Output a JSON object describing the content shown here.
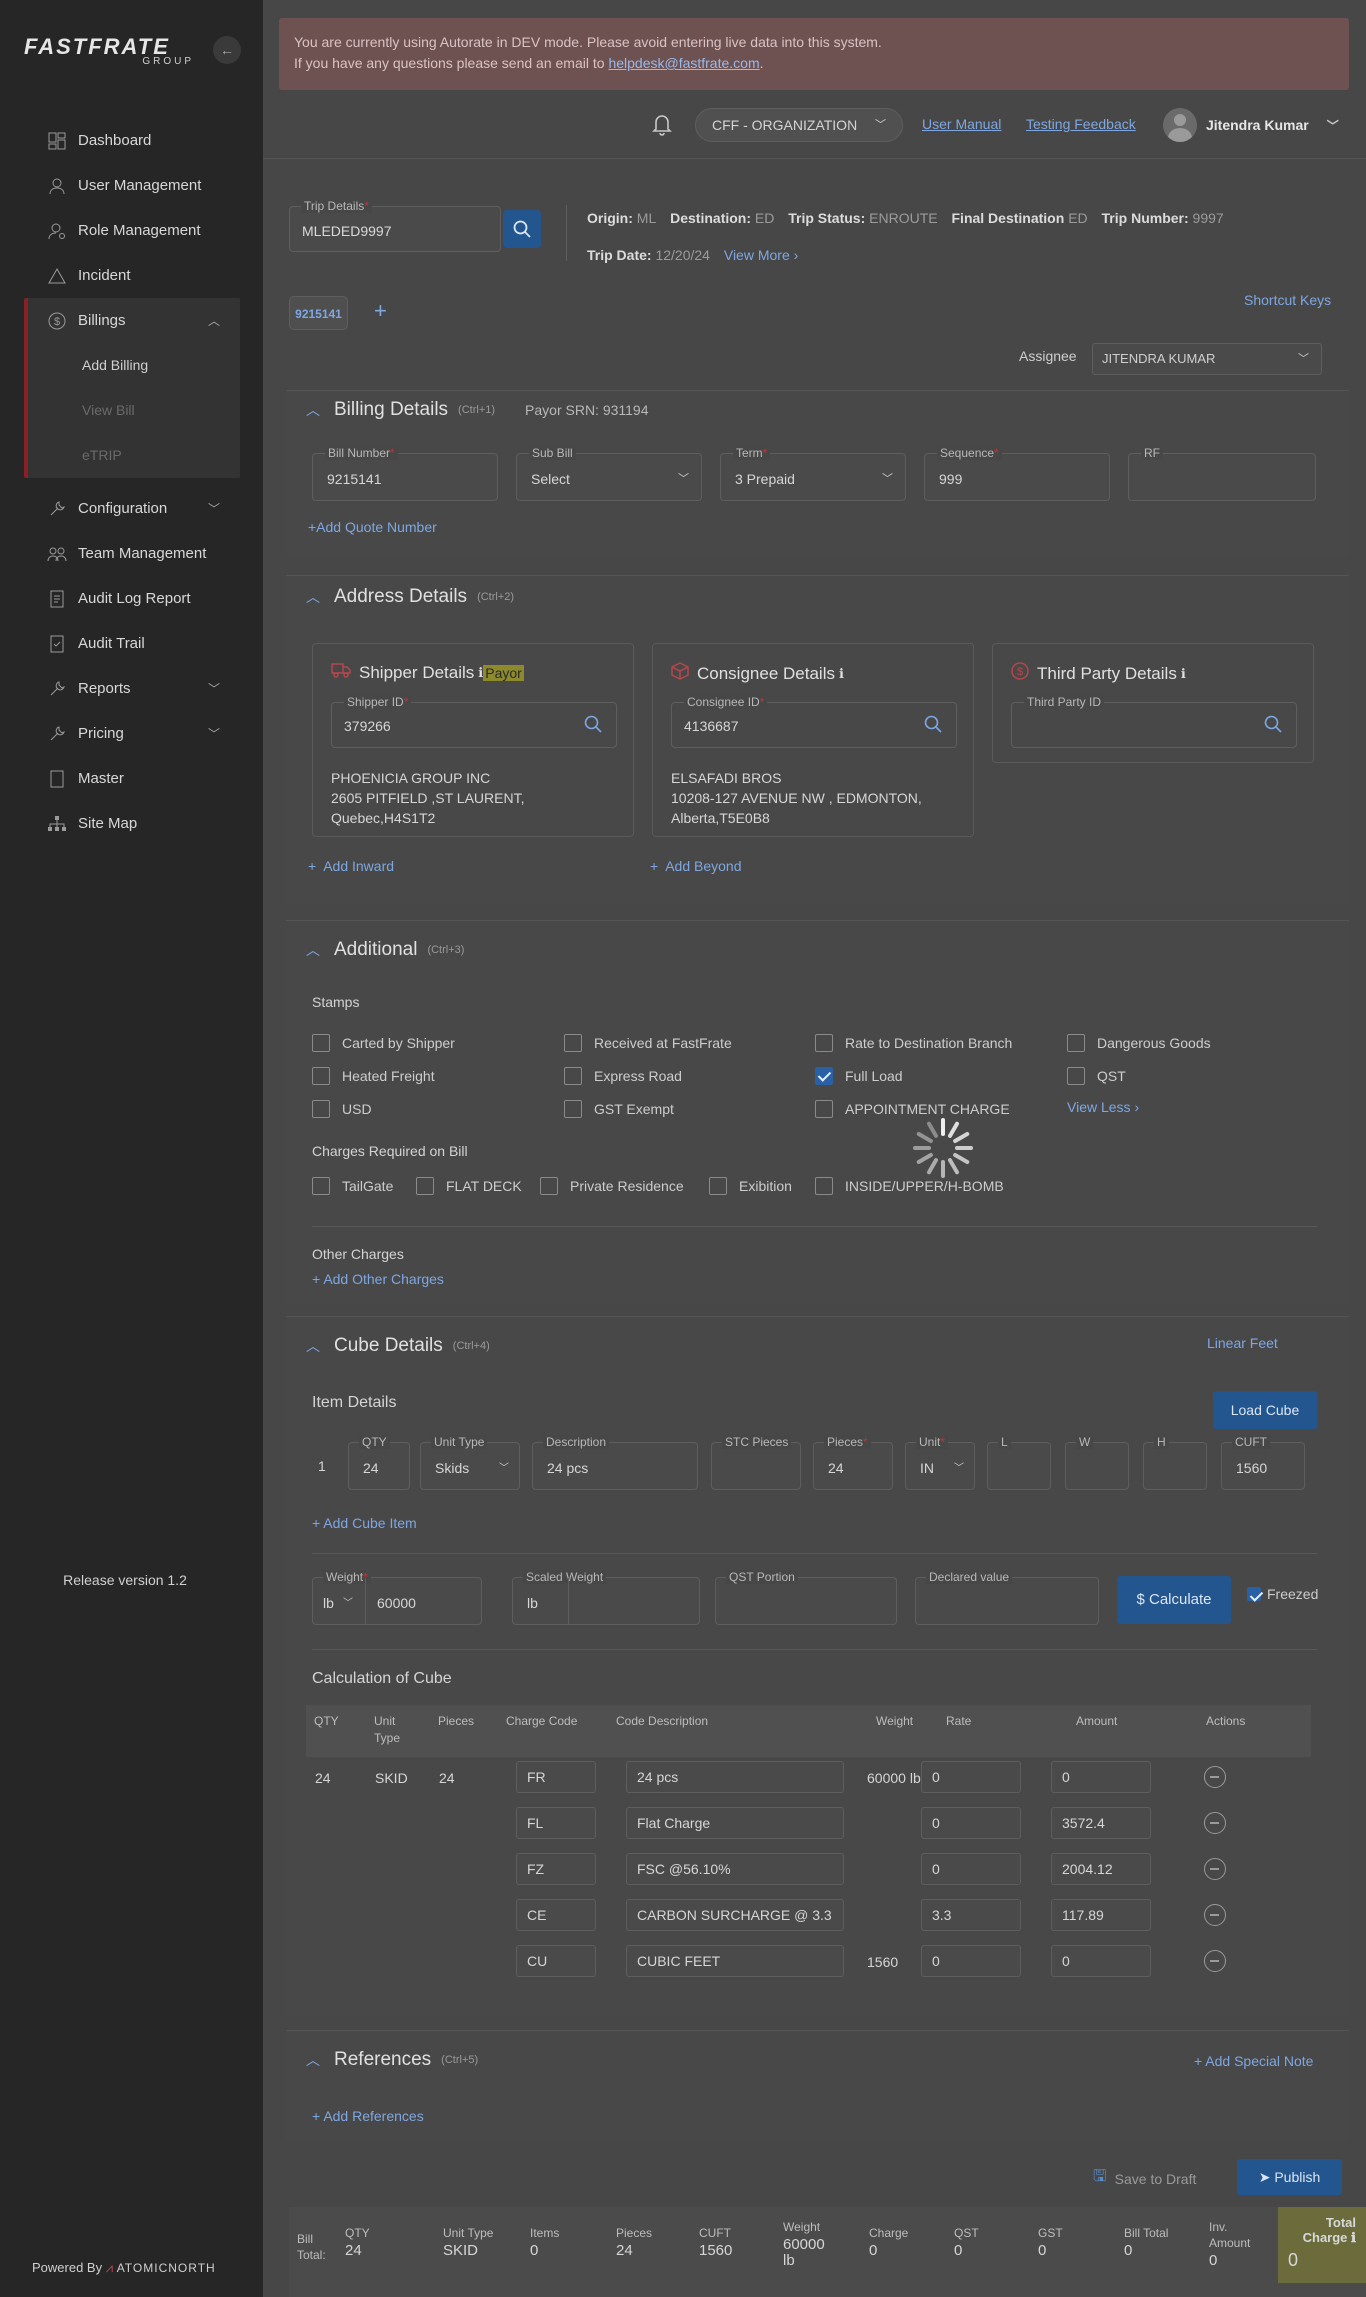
{
  "sidebar": {
    "logo_main": "FASTFRATE",
    "logo_sub": "GROUP",
    "items": [
      {
        "label": "Dashboard",
        "icon": "dashboard-icon"
      },
      {
        "label": "User Management",
        "icon": "user-icon"
      },
      {
        "label": "Role Management",
        "icon": "role-icon"
      },
      {
        "label": "Incident",
        "icon": "warning-icon"
      },
      {
        "label": "Billings",
        "icon": "dollar-icon"
      },
      {
        "label": "Configuration",
        "icon": "wrench-icon"
      },
      {
        "label": "Team Management",
        "icon": "team-icon"
      },
      {
        "label": "Audit Log Report",
        "icon": "report-icon"
      },
      {
        "label": "Audit Trail",
        "icon": "trail-icon"
      },
      {
        "label": "Reports",
        "icon": "wrench-icon"
      },
      {
        "label": "Pricing",
        "icon": "wrench-icon"
      },
      {
        "label": "Master",
        "icon": "doc-icon"
      },
      {
        "label": "Site Map",
        "icon": "sitemap-icon"
      }
    ],
    "billing_sub": [
      "Add Billing",
      "View Bill",
      "eTRIP"
    ],
    "release": "Release version 1.2",
    "powered_by": "Powered By",
    "powered_brand": "ATOMICNORTH"
  },
  "banner": {
    "line1": "You are currently using Autorate in DEV mode. Please avoid entering live data into this system.",
    "line2_pre": "If you have any questions please send an email to",
    "email": "helpdesk@fastfrate.com",
    "line2_post": "."
  },
  "topbar": {
    "org": "CFF - ORGANIZATION",
    "user_manual": "User Manual",
    "testing_feedback": "Testing Feedback",
    "user_name": "Jitendra Kumar"
  },
  "trip": {
    "field_label": "Trip Details",
    "field_value": "MLEDED9997",
    "origin_label": "Origin:",
    "origin": "ML",
    "dest_label": "Destination:",
    "dest": "ED",
    "status_label": "Trip Status:",
    "status": "ENROUTE",
    "final_label": "Final Destination",
    "final": "ED",
    "number_label": "Trip Number:",
    "number": "9997",
    "date_label": "Trip Date:",
    "date": "12/20/24",
    "view_more": "View More"
  },
  "tabs": {
    "active": "9215141",
    "plus": "+",
    "shortcut": "Shortcut Keys"
  },
  "assignee": {
    "label": "Assignee",
    "value": "JITENDRA KUMAR"
  },
  "billing": {
    "title": "Billing Details",
    "shortcut": "(Ctrl+1)",
    "payor_srn": "Payor SRN: 931194",
    "bill_number_label": "Bill Number",
    "bill_number": "9215141",
    "sub_bill_label": "Sub Bill",
    "sub_bill": "Select",
    "term_label": "Term",
    "term": "3 Prepaid",
    "sequence_label": "Sequence",
    "sequence": "999",
    "rf_label": "RF",
    "add_quote": "+Add Quote Number"
  },
  "address": {
    "title": "Address Details",
    "shortcut": "(Ctrl+2)",
    "shipper": {
      "title": "Shipper Details",
      "payor": "Payor",
      "id_label": "Shipper ID",
      "id": "379266",
      "line1": "PHOENICIA GROUP INC",
      "line2": "2605 PITFIELD   ,ST LAURENT,",
      "line3": "Quebec,H4S1T2"
    },
    "consignee": {
      "title": "Consignee Details",
      "id_label": "Consignee ID",
      "id": "4136687",
      "line1": "ELSAFADI BROS",
      "line2": "10208-127 AVENUE NW   , EDMONTON,",
      "line3": "Alberta,T5E0B8"
    },
    "third": {
      "title": "Third Party Details",
      "id_label": "Third Party ID"
    },
    "add_inward": "Add Inward",
    "add_beyond": "Add Beyond"
  },
  "additional": {
    "title": "Additional",
    "shortcut": "(Ctrl+3)",
    "stamps_label": "Stamps",
    "stamps": [
      {
        "label": "Carted by Shipper",
        "checked": false
      },
      {
        "label": "Received at FastFrate",
        "checked": false
      },
      {
        "label": "Rate to Destination Branch",
        "checked": false
      },
      {
        "label": "Dangerous Goods",
        "checked": false
      },
      {
        "label": "Heated Freight",
        "checked": false
      },
      {
        "label": "Express Road",
        "checked": false
      },
      {
        "label": "Full Load",
        "checked": true
      },
      {
        "label": "QST",
        "checked": false
      },
      {
        "label": "USD",
        "checked": false
      },
      {
        "label": "GST Exempt",
        "checked": false
      },
      {
        "label": "APPOINTMENT CHARGE",
        "checked": false
      }
    ],
    "view_less": "View Less",
    "charges_label": "Charges Required on Bill",
    "charges": [
      "TailGate",
      "FLAT DECK",
      "Private Residence",
      "Exibition",
      "INSIDE/UPPER/H-BOMB"
    ],
    "other_label": "Other Charges",
    "add_other": "Add Other Charges"
  },
  "cube": {
    "title": "Cube Details",
    "shortcut": "(Ctrl+4)",
    "linear_feet": "Linear Feet",
    "item_details": "Item Details",
    "load_cube": "Load Cube",
    "row": {
      "index": "1",
      "qty_label": "QTY",
      "qty": "24",
      "unit_type_label": "Unit Type",
      "unit_type": "Skids",
      "desc_label": "Description",
      "desc": "24 pcs",
      "stc_label": "STC Pieces",
      "pieces_label": "Pieces",
      "pieces": "24",
      "unit_label": "Unit",
      "unit": "IN",
      "l_label": "L",
      "w_label": "W",
      "h_label": "H",
      "cuft_label": "CUFT",
      "cuft": "1560"
    },
    "add_item": "+ Add Cube Item",
    "weight_label": "Weight",
    "weight_unit": "lb",
    "weight": "60000",
    "scaled_label": "Scaled Weight",
    "scaled_unit": "lb",
    "qst_label": "QST Portion",
    "declared_label": "Declared value",
    "calculate": "Calculate",
    "freezed": "Freezed",
    "calc_title": "Calculation of Cube",
    "headers": [
      "QTY",
      "Unit Type",
      "Pieces",
      "Charge Code",
      "Code Description",
      "Weight",
      "Rate",
      "Amount",
      "Actions"
    ],
    "first": {
      "qty": "24",
      "unit": "SKID",
      "pieces": "24"
    },
    "lines": [
      {
        "code": "FR",
        "desc": "24 pcs",
        "weight": "60000",
        "wunit": "lb",
        "rate": "0",
        "amount": "0"
      },
      {
        "code": "FL",
        "desc": "Flat Charge",
        "weight": "",
        "wunit": "",
        "rate": "0",
        "amount": "3572.4"
      },
      {
        "code": "FZ",
        "desc": "FSC @56.10%",
        "weight": "",
        "wunit": "",
        "rate": "0",
        "amount": "2004.12"
      },
      {
        "code": "CE",
        "desc": "CARBON SURCHARGE @ 3.3",
        "weight": "",
        "wunit": "",
        "rate": "3.3",
        "amount": "117.89"
      },
      {
        "code": "CU",
        "desc": "CUBIC FEET",
        "weight": "1560",
        "wunit": "",
        "rate": "0",
        "amount": "0"
      }
    ]
  },
  "references": {
    "title": "References",
    "shortcut": "(Ctrl+5)",
    "add_special": "+ Add Special Note",
    "add_refs": "Add References"
  },
  "footer": {
    "save_draft": "Save to Draft",
    "publish": "Publish"
  },
  "totals": {
    "bill_total": "Bill Total:",
    "cols": [
      {
        "label": "QTY",
        "value": "24"
      },
      {
        "label": "Unit Type",
        "value": "SKID"
      },
      {
        "label": "Items",
        "value": "0"
      },
      {
        "label": "Pieces",
        "value": "24"
      },
      {
        "label": "CUFT",
        "value": "1560"
      },
      {
        "label": "Weight",
        "value": "60000 lb"
      },
      {
        "label": "Charge",
        "value": "0"
      },
      {
        "label": "QST",
        "value": "0"
      },
      {
        "label": "GST",
        "value": "0"
      },
      {
        "label": "Bill Total",
        "value": "0"
      },
      {
        "label": "Inv. Amount",
        "value": "0"
      }
    ],
    "grand_label": "Total Charge",
    "grand": "0"
  }
}
